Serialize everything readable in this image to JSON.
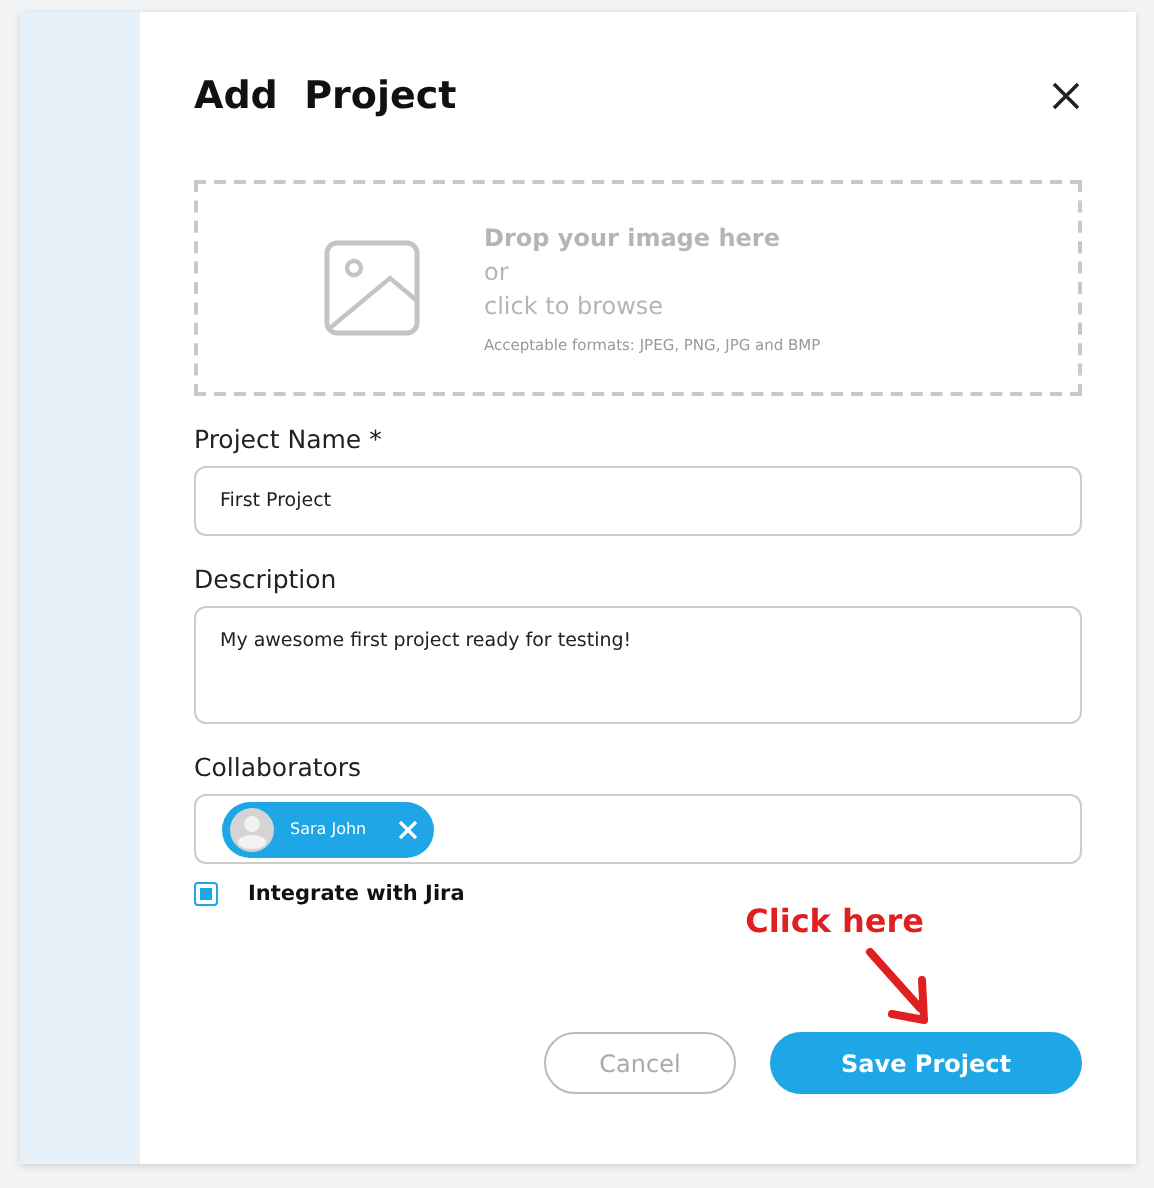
{
  "dialog": {
    "title": "Add  Project"
  },
  "upload": {
    "prompt": "Drop your image here",
    "separator": "or",
    "action": "click to browse",
    "hint": "Acceptable formats: JPEG, PNG, JPG and BMP"
  },
  "project_name": {
    "label": "Project Name *",
    "value": "First Project"
  },
  "description": {
    "label": "Description",
    "value": "My awesome first project ready for testing!"
  },
  "collaborators": {
    "label": "Collaborators",
    "chips": [
      {
        "name": "Sara John"
      }
    ]
  },
  "integrate": {
    "label": "Integrate with Jira",
    "checked": true
  },
  "buttons": [
    {
      "label": "Cancel",
      "kind": "secondary"
    },
    {
      "label": "Save Project",
      "kind": "primary"
    }
  ],
  "annotation": {
    "text": "Click here"
  }
}
